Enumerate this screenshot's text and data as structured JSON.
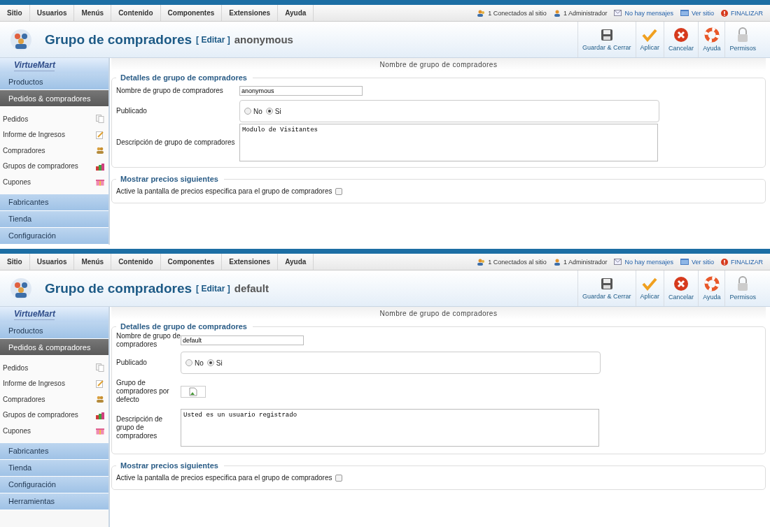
{
  "panels": [
    {
      "menu": [
        {
          "label": "Sitio"
        },
        {
          "label": "Usuarios"
        },
        {
          "label": "Menús"
        },
        {
          "label": "Contenido"
        },
        {
          "label": "Componentes"
        },
        {
          "label": "Extensiones"
        },
        {
          "label": "Ayuda"
        }
      ],
      "status": [
        {
          "kind": "users",
          "label": "1 Conectados al sitio"
        },
        {
          "kind": "admin",
          "label": "1 Administrador"
        },
        {
          "kind": "mail",
          "label": "No hay mensajes"
        },
        {
          "kind": "site",
          "label": "Ver sitio"
        },
        {
          "kind": "logout",
          "label": "FINALIZAR"
        }
      ],
      "title": "Grupo de compradores",
      "edit": "[ Editar ]",
      "record": "anonymous",
      "toolbar": [
        {
          "kind": "save",
          "label": "Guardar & Cerrar"
        },
        {
          "kind": "apply",
          "label": "Aplicar"
        },
        {
          "kind": "cancel",
          "label": "Cancelar"
        },
        {
          "kind": "help",
          "label": "Ayuda"
        },
        {
          "kind": "lock",
          "label": "Permisos"
        }
      ],
      "logo": "VirtueMart",
      "sidebar": [
        {
          "label": "Productos",
          "selected": false
        },
        {
          "label": "Pedidos & compradores",
          "selected": true,
          "children": [
            {
              "label": "Pedidos"
            },
            {
              "label": "Informe de Ingresos"
            },
            {
              "label": "Compradores"
            },
            {
              "label": "Grupos de compradores"
            },
            {
              "label": "Cupones"
            }
          ]
        },
        {
          "label": "Fabricantes",
          "selected": false
        },
        {
          "label": "Tienda",
          "selected": false
        },
        {
          "label": "Configuración",
          "selected": false
        }
      ],
      "tab": "Nombre de grupo de compradores",
      "sections": [
        {
          "legend": "Detalles de grupo de compradores",
          "fields": [
            {
              "kind": "text",
              "label": "Nombre de grupo de compradores",
              "value": "anonymous"
            },
            {
              "kind": "radio",
              "label": "Publicado",
              "options": [
                {
                  "label": "No",
                  "selected": false
                },
                {
                  "label": "Si",
                  "selected": true
                }
              ]
            },
            {
              "kind": "textarea",
              "label": "Descripción de grupo de compradores",
              "value": "Modulo de Visitantes"
            }
          ]
        },
        {
          "legend": "Mostrar precios siguientes",
          "fields": [
            {
              "kind": "checkbox",
              "label": "Active la pantalla de precios especifica para el grupo de compradores",
              "checked": false
            }
          ]
        }
      ]
    },
    {
      "menu": [
        {
          "label": "Sitio"
        },
        {
          "label": "Usuarios"
        },
        {
          "label": "Menús"
        },
        {
          "label": "Contenido"
        },
        {
          "label": "Componentes"
        },
        {
          "label": "Extensiones"
        },
        {
          "label": "Ayuda"
        }
      ],
      "status": [
        {
          "kind": "users",
          "label": "1 Conectados al sitio"
        },
        {
          "kind": "admin",
          "label": "1 Administrador"
        },
        {
          "kind": "mail",
          "label": "No hay mensajes"
        },
        {
          "kind": "site",
          "label": "Ver sitio"
        },
        {
          "kind": "logout",
          "label": "FINALIZAR"
        }
      ],
      "title": "Grupo de compradores",
      "edit": "[ Editar ]",
      "record": "default",
      "toolbar": [
        {
          "kind": "save",
          "label": "Guardar & Cerrar"
        },
        {
          "kind": "apply",
          "label": "Aplicar"
        },
        {
          "kind": "cancel",
          "label": "Cancelar"
        },
        {
          "kind": "help",
          "label": "Ayuda"
        },
        {
          "kind": "lock",
          "label": "Permisos"
        }
      ],
      "logo": "VirtueMart",
      "sidebar": [
        {
          "label": "Productos",
          "selected": false
        },
        {
          "label": "Pedidos & compradores",
          "selected": true,
          "children": [
            {
              "label": "Pedidos"
            },
            {
              "label": "Informe de Ingresos"
            },
            {
              "label": "Compradores"
            },
            {
              "label": "Grupos de compradores"
            },
            {
              "label": "Cupones"
            }
          ]
        },
        {
          "label": "Fabricantes",
          "selected": false
        },
        {
          "label": "Tienda",
          "selected": false
        },
        {
          "label": "Configuración",
          "selected": false
        },
        {
          "label": "Herramientas",
          "selected": false
        }
      ],
      "tab": "Nombre de grupo de compradores",
      "sections": [
        {
          "legend": "Detalles de grupo de compradores",
          "fields": [
            {
              "kind": "text",
              "label": "Nombre de grupo de compradores",
              "value": "default"
            },
            {
              "kind": "radio",
              "label": "Publicado",
              "options": [
                {
                  "label": "No",
                  "selected": false
                },
                {
                  "label": "Si",
                  "selected": true
                }
              ]
            },
            {
              "kind": "image",
              "label": "Grupo de compradores por defecto"
            },
            {
              "kind": "textarea",
              "label": "Descripción de grupo de compradores",
              "value": "Usted es un usuario registrado"
            }
          ]
        },
        {
          "legend": "Mostrar precios siguientes",
          "fields": [
            {
              "kind": "checkbox",
              "label": "Active la pantalla de precios especifica para el grupo de compradores",
              "checked": false
            }
          ]
        }
      ]
    }
  ]
}
